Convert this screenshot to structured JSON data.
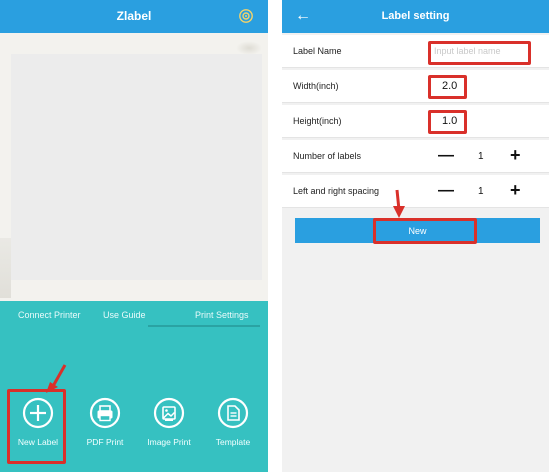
{
  "left": {
    "header": {
      "title": "Zlabel",
      "settings_icon": "gear-icon"
    },
    "tabs": [
      {
        "label": "Connect Printer"
      },
      {
        "label": "Use Guide"
      },
      {
        "label": "Print Settings"
      }
    ],
    "actions": [
      {
        "label": "New Label",
        "icon": "plus-circle-icon"
      },
      {
        "label": "PDF Print",
        "icon": "printer-icon"
      },
      {
        "label": "Image Print",
        "icon": "image-icon"
      },
      {
        "label": "Template",
        "icon": "document-icon"
      }
    ]
  },
  "right": {
    "header": {
      "title": "Label setting",
      "back_icon": "←"
    },
    "form": {
      "label_name": {
        "label": "Label Name",
        "placeholder": "Input label name"
      },
      "width": {
        "label": "Width(inch)",
        "value": "2.0"
      },
      "height": {
        "label": "Height(inch)",
        "value": "1.0"
      },
      "number_of_labels": {
        "label": "Number of labels",
        "minus": "—",
        "value": "1",
        "plus": "+"
      },
      "spacing": {
        "label": "Left and right spacing",
        "minus": "—",
        "value": "1",
        "plus": "+"
      }
    },
    "new_button": {
      "label": "New"
    }
  },
  "colors": {
    "header_blue": "#2a9fe0",
    "teal": "#36c1c1",
    "highlight_red": "#d9302a",
    "background_gray": "#f1f1f1"
  }
}
